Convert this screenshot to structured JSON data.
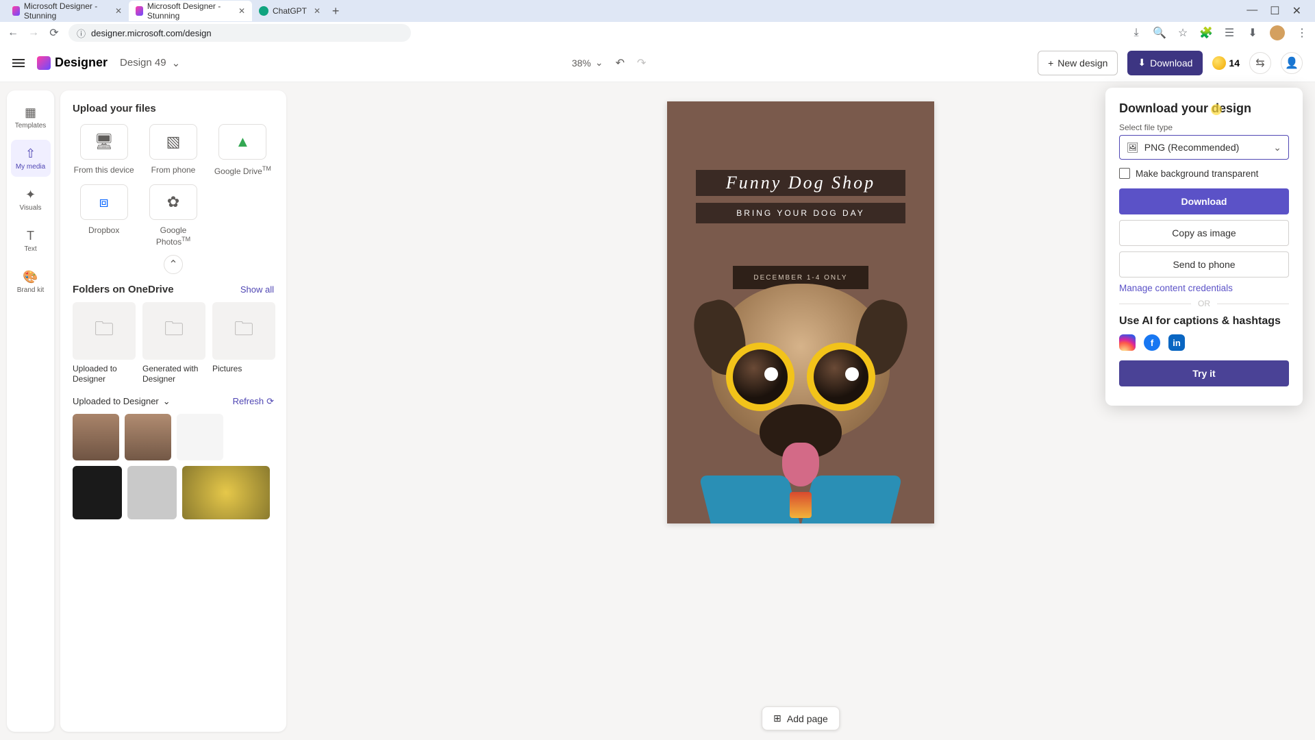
{
  "browser": {
    "tabs": [
      {
        "title": "Microsoft Designer - Stunning"
      },
      {
        "title": "Microsoft Designer - Stunning"
      },
      {
        "title": "ChatGPT"
      }
    ],
    "url": "designer.microsoft.com/design"
  },
  "header": {
    "logo": "Designer",
    "designName": "Design 49",
    "zoom": "38%",
    "newDesign": "New design",
    "download": "Download",
    "credits": "14"
  },
  "rail": {
    "templates": "Templates",
    "myMedia": "My media",
    "visuals": "Visuals",
    "text": "Text",
    "brandKit": "Brand kit"
  },
  "panel": {
    "uploadTitle": "Upload your files",
    "sources": {
      "device": "From this device",
      "phone": "From phone",
      "gdrive": "Google Drive",
      "gdriveTM": "TM",
      "dropbox": "Dropbox",
      "gphotos": "Google Photos",
      "gphotosTM": "TM"
    },
    "foldersTitle": "Folders on OneDrive",
    "showAll": "Show all",
    "folders": {
      "uploaded": "Uploaded to Designer",
      "generated": "Generated with Designer",
      "pictures": "Pictures"
    },
    "sectionName": "Uploaded to Designer",
    "refresh": "Refresh"
  },
  "canvas": {
    "scriptTitle": "Funny Dog Shop",
    "subtitle": "BRING YOUR DOG DAY",
    "dateline": "DECEMBER 1-4 ONLY",
    "addPage": "Add page"
  },
  "popover": {
    "title": "Download your design",
    "fileTypeLabel": "Select file type",
    "fileType": "PNG (Recommended)",
    "transparent": "Make background transparent",
    "download": "Download",
    "copy": "Copy as image",
    "send": "Send to phone",
    "manage": "Manage content credentials",
    "or": "OR",
    "aiTitle": "Use AI for captions & hashtags",
    "tryIt": "Try it"
  }
}
